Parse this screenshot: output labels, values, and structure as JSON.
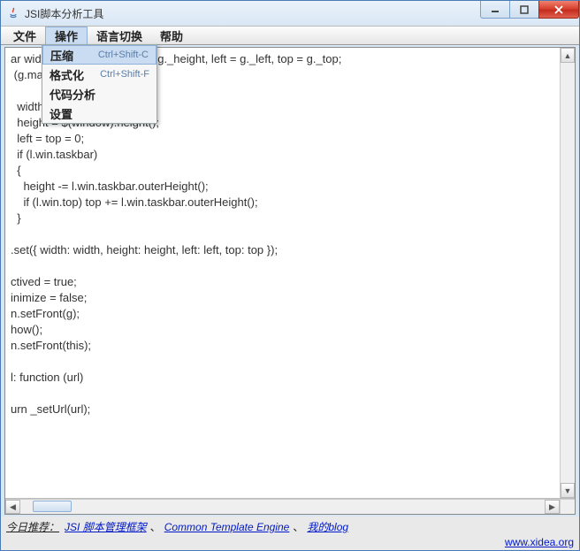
{
  "window": {
    "title": "JSI脚本分析工具"
  },
  "menubar": {
    "items": [
      "文件",
      "操作",
      "语言切换",
      "帮助"
    ],
    "active_index": 1
  },
  "dropdown": {
    "items": [
      {
        "label": "压缩",
        "shortcut": "Ctrl+Shift-C",
        "highlight": true
      },
      {
        "label": "格式化",
        "shortcut": "Ctrl+Shift-F",
        "highlight": false
      },
      {
        "label": "代码分析",
        "shortcut": "",
        "highlight": false
      },
      {
        "label": "设置",
        "shortcut": "",
        "highlight": false
      }
    ]
  },
  "editor": {
    "content": "ar width = g._width, height = g._height, left = g._left, top = g._top;\n (g.max\n\n  width = $(window).width();\n  height = $(window).height();\n  left = top = 0;\n  if (l.win.taskbar)\n  {\n    height -= l.win.taskbar.outerHeight();\n    if (l.win.top) top += l.win.taskbar.outerHeight();\n  }\n\n.set({ width: width, height: height, left: left, top: top });\n\nctived = true;\ninimize = false;\nn.setFront(g);\nhow();\nn.setFront(this);\n\nl: function (url)\n\nurn _setUrl(url);"
  },
  "statusbar": {
    "label": "今日推荐：",
    "links": [
      "JSI 脚本管理框架",
      "Common Template Engine",
      "我的blog"
    ],
    "sep": "、",
    "site": "www.xidea.org"
  }
}
